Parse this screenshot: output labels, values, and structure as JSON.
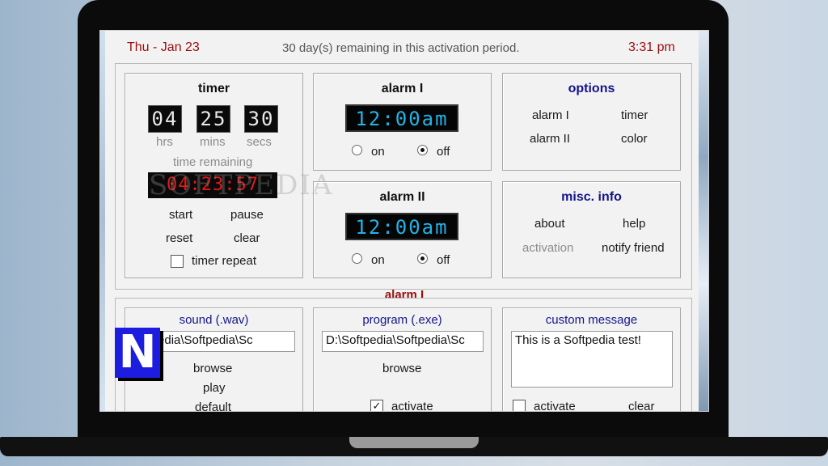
{
  "header": {
    "date": "Thu - Jan 23",
    "remaining": "30 day(s) remaining in this activation period.",
    "time": "3:31 pm"
  },
  "timer": {
    "title": "timer",
    "hrs": "04",
    "mins": "25",
    "secs": "30",
    "hrs_label": "hrs",
    "mins_label": "mins",
    "secs_label": "secs",
    "remaining_label": "time remaining",
    "remaining_value": "04:23:57",
    "start": "start",
    "pause": "pause",
    "reset": "reset",
    "clear": "clear",
    "repeat_label": "timer repeat"
  },
  "alarm1": {
    "title": "alarm I",
    "time": "12:00am",
    "on": "on",
    "off": "off"
  },
  "alarm2": {
    "title": "alarm II",
    "time": "12:00am",
    "on": "on",
    "off": "off"
  },
  "options": {
    "title": "options",
    "alarm1": "alarm I",
    "timer": "timer",
    "alarm2": "alarm II",
    "color": "color"
  },
  "misc": {
    "title": "misc. info",
    "about": "about",
    "help": "help",
    "activation": "activation",
    "notify": "notify friend"
  },
  "bottom": {
    "section_title": "alarm I",
    "sound_title": "sound (.wav)",
    "sound_path": "oftpedia\\Softpedia\\Sc",
    "browse": "browse",
    "play": "play",
    "default": "default",
    "program_title": "program (.exe)",
    "program_path": "D:\\Softpedia\\Softpedia\\Sc",
    "program_browse": "browse",
    "program_activate": "activate",
    "message_title": "custom message",
    "message_text": "This is a Softpedia test!",
    "message_activate": "activate",
    "message_clear": "clear"
  },
  "watermark": "SOFTPEDIA",
  "logo": "N",
  "colors": {
    "accent_red": "#9b0d0d",
    "accent_blue": "#14148a",
    "lcd_cyan": "#23b3e6",
    "timer_red": "#e01a1a"
  }
}
